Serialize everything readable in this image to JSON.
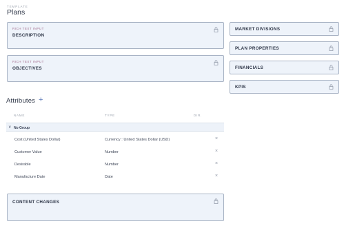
{
  "header": {
    "kicker": "TEMPLATE",
    "title": "Plans"
  },
  "cards": {
    "description": {
      "kicker": "RICH TEXT INPUT",
      "title": "DESCRIPTION"
    },
    "objectives": {
      "kicker": "RICH TEXT INPUT",
      "title": "OBJECTIVES"
    },
    "content_changes": {
      "title": "CONTENT CHANGES"
    }
  },
  "side_cards": [
    {
      "title": "MARKET DIVISIONS"
    },
    {
      "title": "PLAN PROPERTIES"
    },
    {
      "title": "FINANCIALS"
    },
    {
      "title": "KPIS"
    }
  ],
  "attributes": {
    "title": "Attributes",
    "add_symbol": "+",
    "columns": {
      "name": "NAME",
      "type": "TYPE",
      "dir": "DIR."
    },
    "group": {
      "chevron": "∨",
      "label": "No Group"
    },
    "remove_symbol": "×",
    "rows": [
      {
        "name": "Cost (United States Dollar)",
        "type": "Currency : United States Dollar (USD)"
      },
      {
        "name": "Customer Value",
        "type": "Number"
      },
      {
        "name": "Desirable",
        "type": "Number"
      },
      {
        "name": "Manufacture Date",
        "type": "Date"
      }
    ]
  },
  "colors": {
    "card_bg": "#eef3fa",
    "card_border": "#a8b3c4",
    "kicker_accent": "#a1698a",
    "plus_accent": "#5b78b8"
  },
  "icons": {
    "lock": "lock-icon",
    "remove": "close-icon",
    "group_toggle": "chevron-down-icon",
    "add": "plus-icon"
  }
}
